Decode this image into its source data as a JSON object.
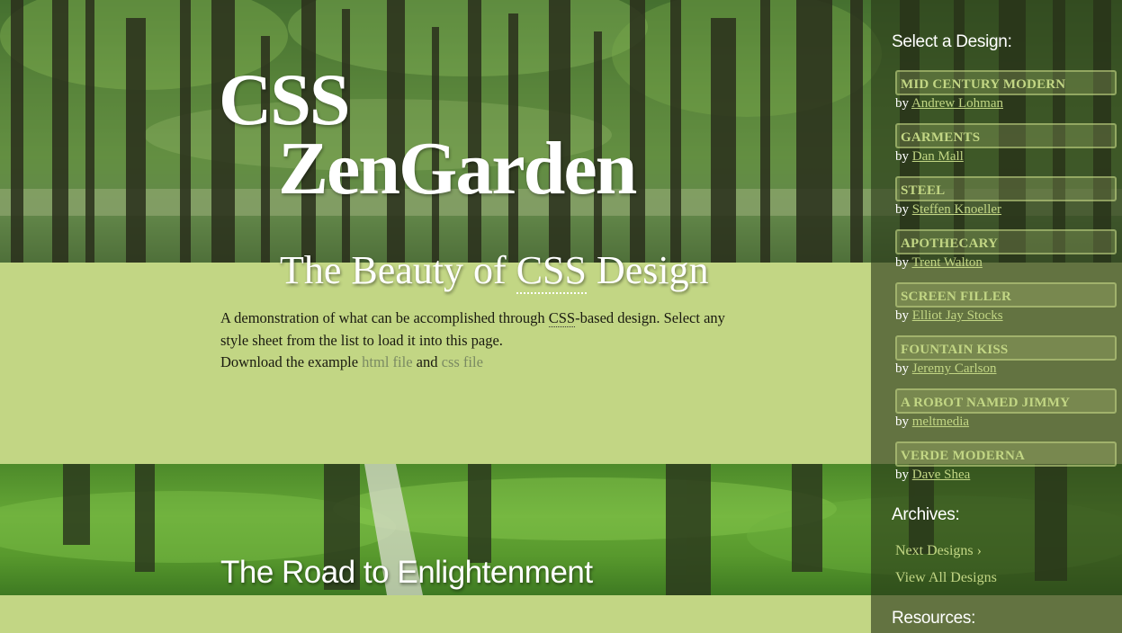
{
  "header": {
    "logo_line1": "CSS",
    "logo_line2": "ZenGarden",
    "tagline_prefix": "The Beauty of ",
    "tagline_abbr": "CSS",
    "tagline_suffix": " Design"
  },
  "intro": {
    "text_1": "A demonstration of what can be accomplished through ",
    "abbr": "CSS",
    "text_2": "-based design. Select any style sheet from the list to load it into this page.",
    "download_prefix": "Download the example ",
    "html_link": "html file",
    "and_text": " and ",
    "css_link": "css file"
  },
  "road": {
    "heading": "The Road to Enlightenment"
  },
  "sidebar": {
    "select_heading": "Select a Design:",
    "by_label": "by ",
    "designs": [
      {
        "name": "MID CENTURY MODERN",
        "author": "Andrew Lohman"
      },
      {
        "name": "GARMENTS",
        "author": "Dan Mall"
      },
      {
        "name": "STEEL",
        "author": "Steffen Knoeller"
      },
      {
        "name": "APOTHECARY",
        "author": "Trent Walton"
      },
      {
        "name": "SCREEN FILLER",
        "author": "Elliot Jay Stocks"
      },
      {
        "name": "FOUNTAIN KISS",
        "author": "Jeremy Carlson"
      },
      {
        "name": "A ROBOT NAMED JIMMY",
        "author": "meltmedia"
      },
      {
        "name": "VERDE MODERNA",
        "author": "Dave Shea"
      }
    ],
    "archives_heading": "Archives:",
    "next_designs": "Next Designs ›",
    "view_all": "View All Designs",
    "resources_heading": "Resources:"
  },
  "colors": {
    "band_green": "#c2d684",
    "sidebar_overlay": "#28371a",
    "link_muted": "#7a8a62",
    "design_link": "#c2d684"
  }
}
